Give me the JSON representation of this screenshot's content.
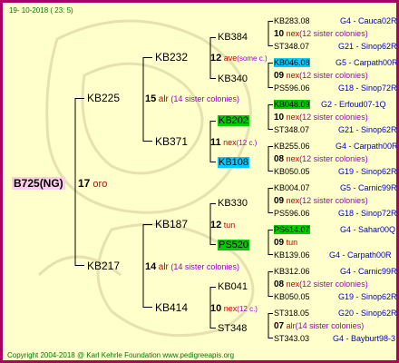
{
  "header": {
    "date": "19- 10-2018 ( 23: 5)"
  },
  "root": {
    "label": "B725(NG)",
    "num": "17",
    "ind": "oro"
  },
  "gen1": [
    {
      "label": "KB225",
      "num": "15",
      "ind": "alr",
      "sis": "(14 sister colonies)"
    },
    {
      "label": "KB217",
      "num": "14",
      "ind": "alr",
      "sis": "(14 sister colonies)"
    }
  ],
  "gen2": [
    {
      "label": "KB232",
      "num": "12",
      "ind": "ave",
      "sis": "(some c.)"
    },
    {
      "label": "KB371",
      "num": "11",
      "ind": "nex",
      "sis": "(12 c.)"
    },
    {
      "label": "KB187",
      "num": "12",
      "ind": "tun",
      "sis": ""
    },
    {
      "label": "KB414",
      "num": "10",
      "ind": "nex",
      "sis": "(12 c.)"
    }
  ],
  "gen3": [
    {
      "label": "KB384",
      "num": "",
      "ind": "",
      "sis": ""
    },
    {
      "label": "KB340",
      "num": "",
      "ind": "",
      "sis": ""
    },
    {
      "label": "KB202",
      "num": "",
      "ind": "",
      "sis": ""
    },
    {
      "label": "KB108",
      "num": "",
      "ind": "",
      "sis": ""
    },
    {
      "label": "KB330",
      "num": "",
      "ind": "",
      "sis": ""
    },
    {
      "label": "PS520",
      "num": "",
      "ind": "",
      "sis": ""
    },
    {
      "label": "KB041",
      "num": "",
      "ind": "",
      "sis": ""
    },
    {
      "label": "ST348",
      "num": "",
      "ind": "",
      "sis": ""
    }
  ],
  "gen4": [
    {
      "top": "KB283.08",
      "topRef": "G4 - Cauca02R",
      "num": "10",
      "ind": "nex",
      "sis": "(12 sister colonies)",
      "bottom": "ST348.07",
      "bottomRef": "G21 - Sinop62R"
    },
    {
      "top": "KB046.08",
      "topRef": "G5 - Carpath00R",
      "num": "09",
      "ind": "nex",
      "sis": "(12 sister colonies)",
      "bottom": "PS596.06",
      "bottomRef": "G18 - Sinop72R"
    },
    {
      "top": "KB048.09",
      "topRef": "G2 - Erfoud07-1Q",
      "num": "10",
      "ind": "nex",
      "sis": "(12 sister colonies)",
      "bottom": "ST348.07",
      "bottomRef": "G21 - Sinop62R"
    },
    {
      "top": "KB255.06",
      "topRef": "G4 - Carpath00R",
      "num": "08",
      "ind": "nex",
      "sis": "(12 sister colonies)",
      "bottom": "KB050.05",
      "bottomRef": "G19 - Sinop62R"
    },
    {
      "top": "KB004.07",
      "topRef": "G5 - Carnic99R",
      "num": "09",
      "ind": "nex",
      "sis": "(12 sister colonies)",
      "bottom": "PS596.06",
      "bottomRef": "G18 - Sinop72R"
    },
    {
      "top": "PS614.07",
      "topRef": "G4 - Sahar00Q",
      "num": "09",
      "ind": "tun",
      "sis": "",
      "bottom": "KB139.06",
      "bottomRef": "G4 - Carpath00R"
    },
    {
      "top": "KB312.06",
      "topRef": "G4 - Carnic99R",
      "num": "08",
      "ind": "nex",
      "sis": "(12 sister colonies)",
      "bottom": "KB050.05",
      "bottomRef": "G19 - Sinop62R"
    },
    {
      "top": "ST318.05",
      "topRef": "G20 - Sinop62R",
      "num": "07",
      "ind": "alr",
      "sis": "(14 sister colonies)",
      "bottom": "ST343.03",
      "bottomRef": "G4 - Bayburt98-3"
    }
  ],
  "footer": {
    "copyright": "Copyright 2004-2018 @ Karl Kehrle Foundation    www.pedigreeapis.org"
  },
  "colors": {
    "border": "#aa0066",
    "background": "#ffffcc",
    "lines": "#000000",
    "highlightGreen": "#00cc00",
    "highlightCyan": "#00ccff"
  }
}
